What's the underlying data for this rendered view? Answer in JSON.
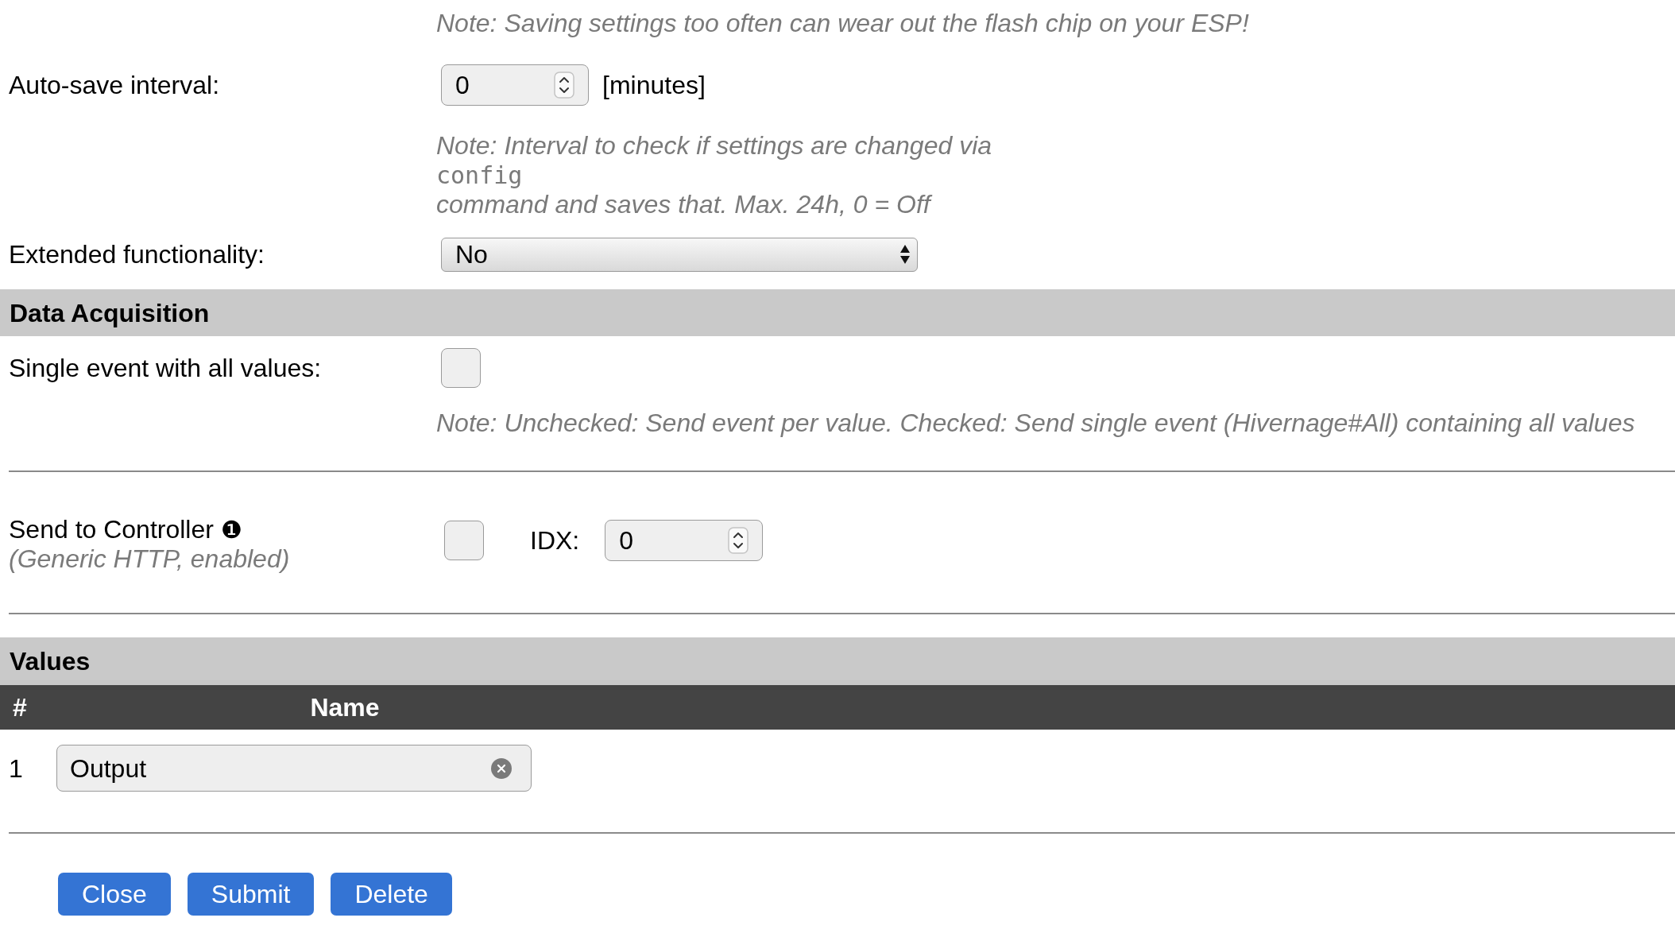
{
  "form_rows": [
    {
      "kind": "note",
      "text": "Note: Saving settings too often can wear out the flash chip on your ESP!"
    },
    {
      "kind": "number",
      "label": "Auto-save interval:",
      "value": "0",
      "unit": "[minutes]"
    },
    {
      "kind": "note",
      "text": "Note: Interval to check if settings are changed via",
      "code": "config",
      "text_after": "command and saves that. Max. 24h, 0 = Off"
    },
    {
      "kind": "select",
      "label": "Extended functionality:",
      "value": "No"
    },
    {
      "kind": "section",
      "title": "Data Acquisition"
    },
    {
      "kind": "checkbox",
      "label": "Single event with all values:",
      "checked": false
    },
    {
      "kind": "note",
      "text": "Note: Unchecked: Send event per value. Checked: Send single event (Hivernage#All) containing all values"
    },
    {
      "kind": "divider"
    },
    {
      "kind": "controller",
      "label": "Send to Controller",
      "info": "❶",
      "sublabel": "(Generic HTTP, enabled)",
      "checked": false,
      "idx_label": "IDX:",
      "idx_value": "0"
    },
    {
      "kind": "divider"
    }
  ],
  "values": {
    "title": "Values",
    "columns": [
      "#",
      "Name"
    ],
    "rows": [
      {
        "number": "1",
        "name": "Output"
      }
    ]
  },
  "buttons": [
    "Close",
    "Submit",
    "Delete"
  ]
}
